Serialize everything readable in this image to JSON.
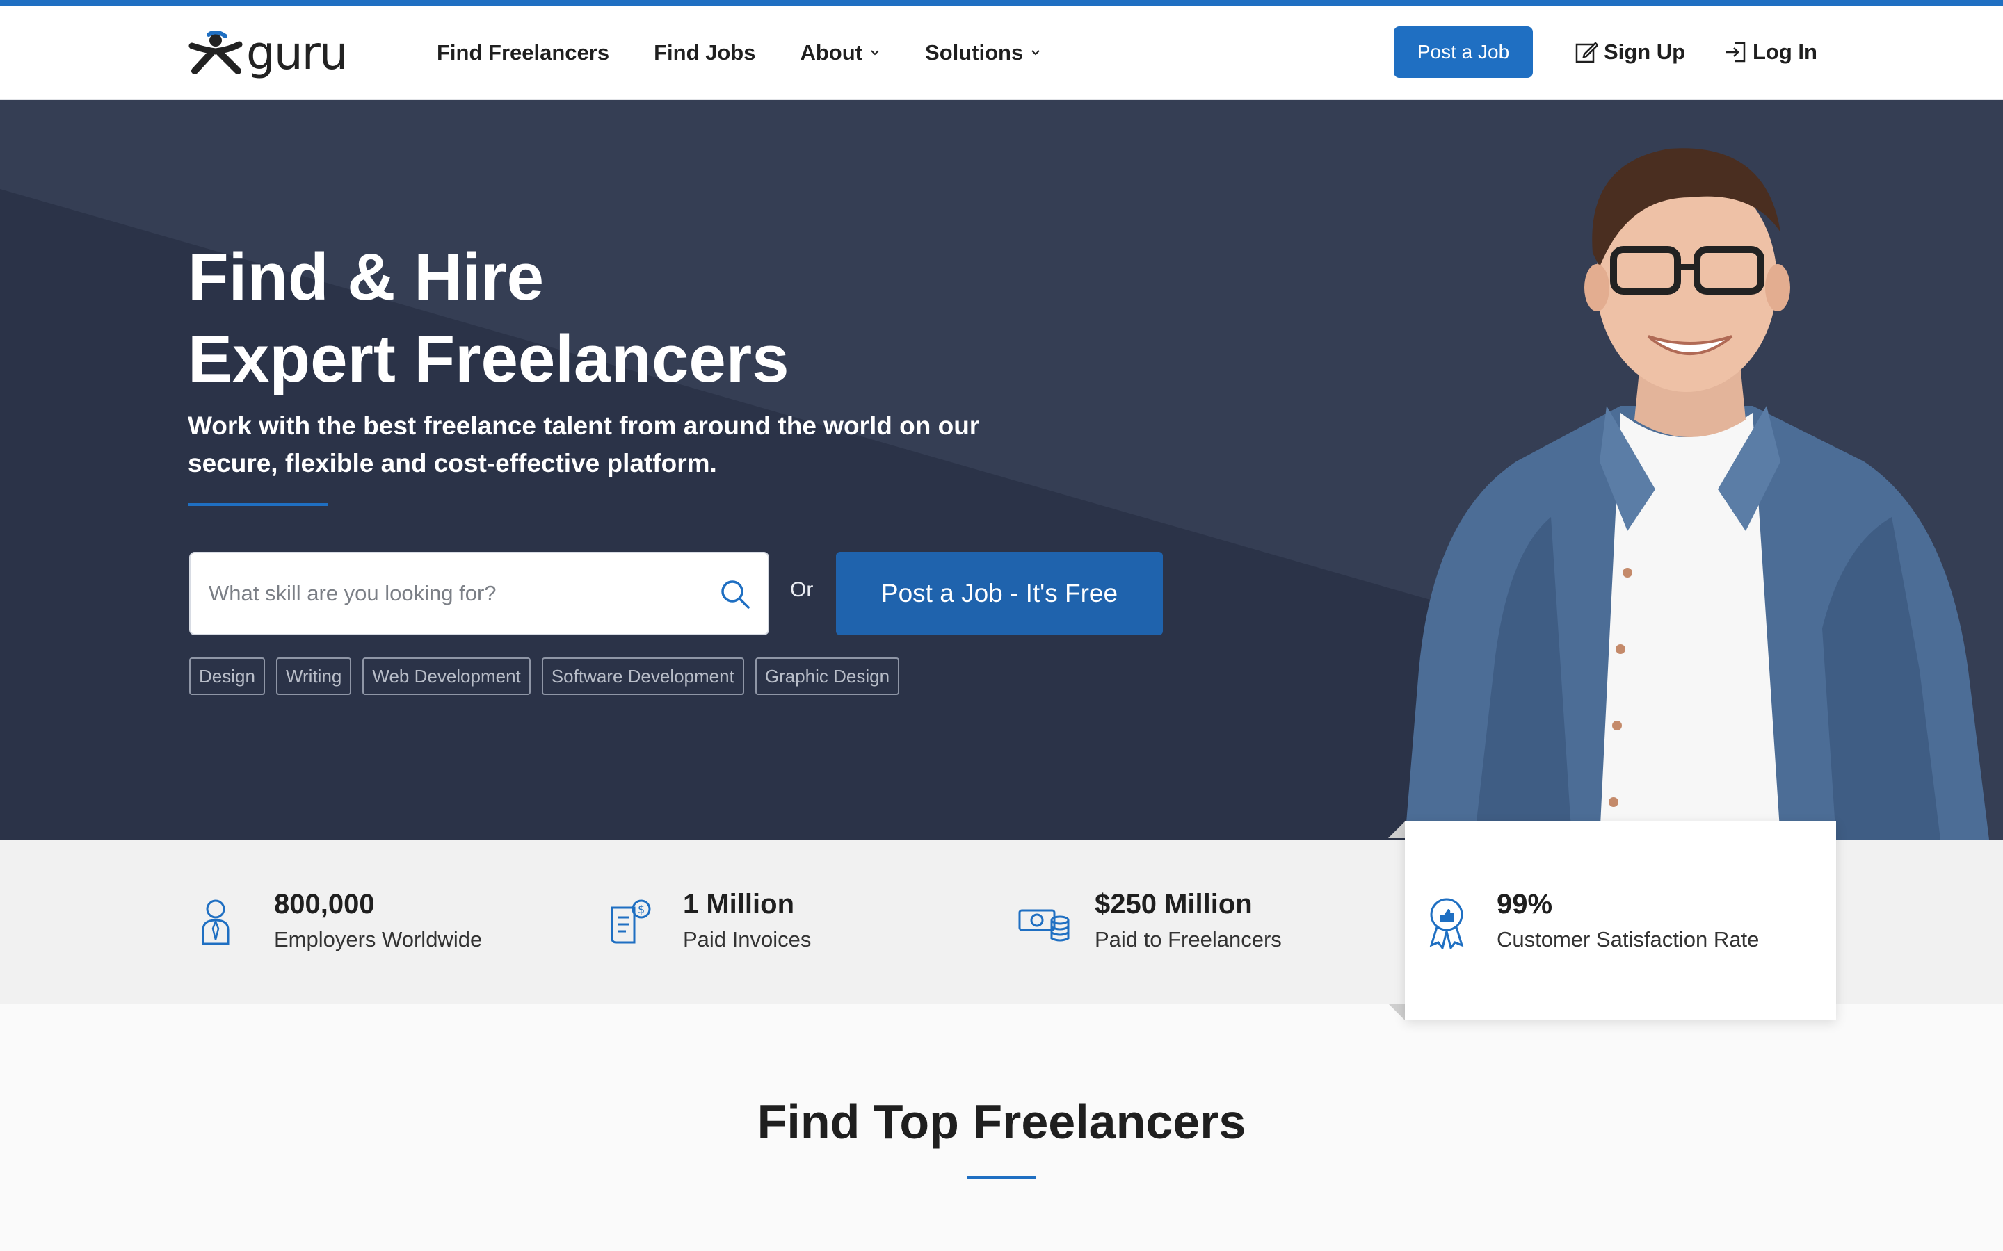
{
  "header": {
    "logo_text": "guru",
    "nav": [
      {
        "label": "Find Freelancers",
        "has_dropdown": false
      },
      {
        "label": "Find Jobs",
        "has_dropdown": false
      },
      {
        "label": "About",
        "has_dropdown": true
      },
      {
        "label": "Solutions",
        "has_dropdown": true
      }
    ],
    "post_job_label": "Post a Job",
    "signup_label": "Sign Up",
    "login_label": "Log In"
  },
  "hero": {
    "title_line1": "Find & Hire",
    "title_line2": "Expert Freelancers",
    "subtitle": "Work with the best freelance talent from around the world on our secure, flexible and cost-effective platform.",
    "search_placeholder": "What skill are you looking for?",
    "or_text": "Or",
    "post_job_cta": "Post a Job - It's Free",
    "tags": [
      "Design",
      "Writing",
      "Web Development",
      "Software Development",
      "Graphic Design"
    ]
  },
  "stats": [
    {
      "value": "800,000",
      "label": "Employers Worldwide",
      "icon": "employer-icon"
    },
    {
      "value": "1 Million",
      "label": "Paid Invoices",
      "icon": "invoice-icon"
    },
    {
      "value": "$250 Million",
      "label": "Paid to Freelancers",
      "icon": "money-icon"
    },
    {
      "value": "99%",
      "label": "Customer Satisfaction Rate",
      "icon": "award-icon"
    }
  ],
  "section": {
    "title": "Find Top Freelancers"
  },
  "colors": {
    "accent": "#1f6fc2",
    "hero_bg": "#353e54",
    "cta": "#1f63ad"
  }
}
